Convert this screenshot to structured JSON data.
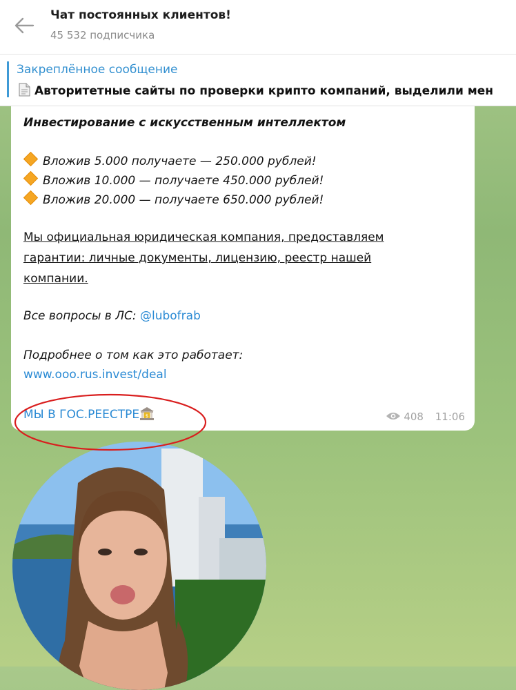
{
  "header": {
    "title": "Чат постоянных клиентов!",
    "subtitle": "45 532 подписчика"
  },
  "pinned": {
    "label": "Закреплённое сообщение",
    "text": "Авторитетные сайты по проверки крипто компаний, выделили мен"
  },
  "message": {
    "heading": "Инвестирование с искусственным интеллектом",
    "offers": [
      {
        "pre": "Вложив 5.000 получаете — ",
        "post": "250.000 рублей!"
      },
      {
        "pre": "Вложив 10.000 — получаете ",
        "post": "450.000 рублей!"
      },
      {
        "pre": "Вложив 20.000 — получаете ",
        "post": "650.000 рублей!"
      }
    ],
    "company_lines": [
      "Мы официальная юридическая компания, предоставляем",
      "гарантии: личные документы, лицензию, реестр нашей",
      "компании."
    ],
    "questions_label": "Все вопросы в ЛС: ",
    "questions_handle": "@lubofrab",
    "more_label": "Подробнее о том как это работает:",
    "more_link": "www.ooo.rus.invest/deal",
    "registry_link": "МЫ В ГОС.РЕЕСТРЕ",
    "views": "408",
    "time": "11:06"
  },
  "colors": {
    "accent": "#2a8ad4",
    "annotation": "#d91e1e"
  }
}
